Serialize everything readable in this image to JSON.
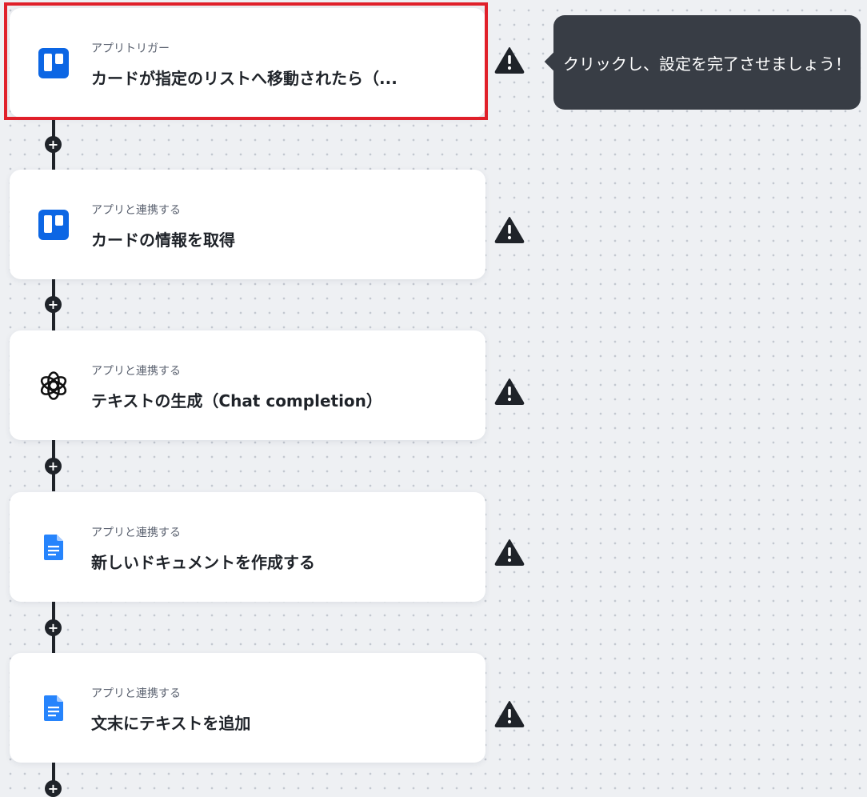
{
  "tooltip": {
    "text": "クリックし、設定を完了させましょう！"
  },
  "steps": [
    {
      "kind": "アプリトリガー",
      "title": "カードが指定のリストへ移動されたら（...",
      "icon": "trello-icon",
      "selected": true,
      "warning": true
    },
    {
      "kind": "アプリと連携する",
      "title": "カードの情報を取得",
      "icon": "trello-icon",
      "warning": true
    },
    {
      "kind": "アプリと連携する",
      "title": "テキストの生成（Chat completion）",
      "icon": "openai-icon",
      "warning": true
    },
    {
      "kind": "アプリと連携する",
      "title": "新しいドキュメントを作成する",
      "icon": "google-docs-icon",
      "warning": true
    },
    {
      "kind": "アプリと連携する",
      "title": "文末にテキストを追加",
      "icon": "google-docs-icon",
      "warning": true
    }
  ],
  "add_step_symbol": "+",
  "colors": {
    "trello": "#0c66e4",
    "docs": "#2684fc",
    "warning": "#1f2329",
    "highlight": "#e0202a",
    "tooltip_bg": "#383d45"
  }
}
